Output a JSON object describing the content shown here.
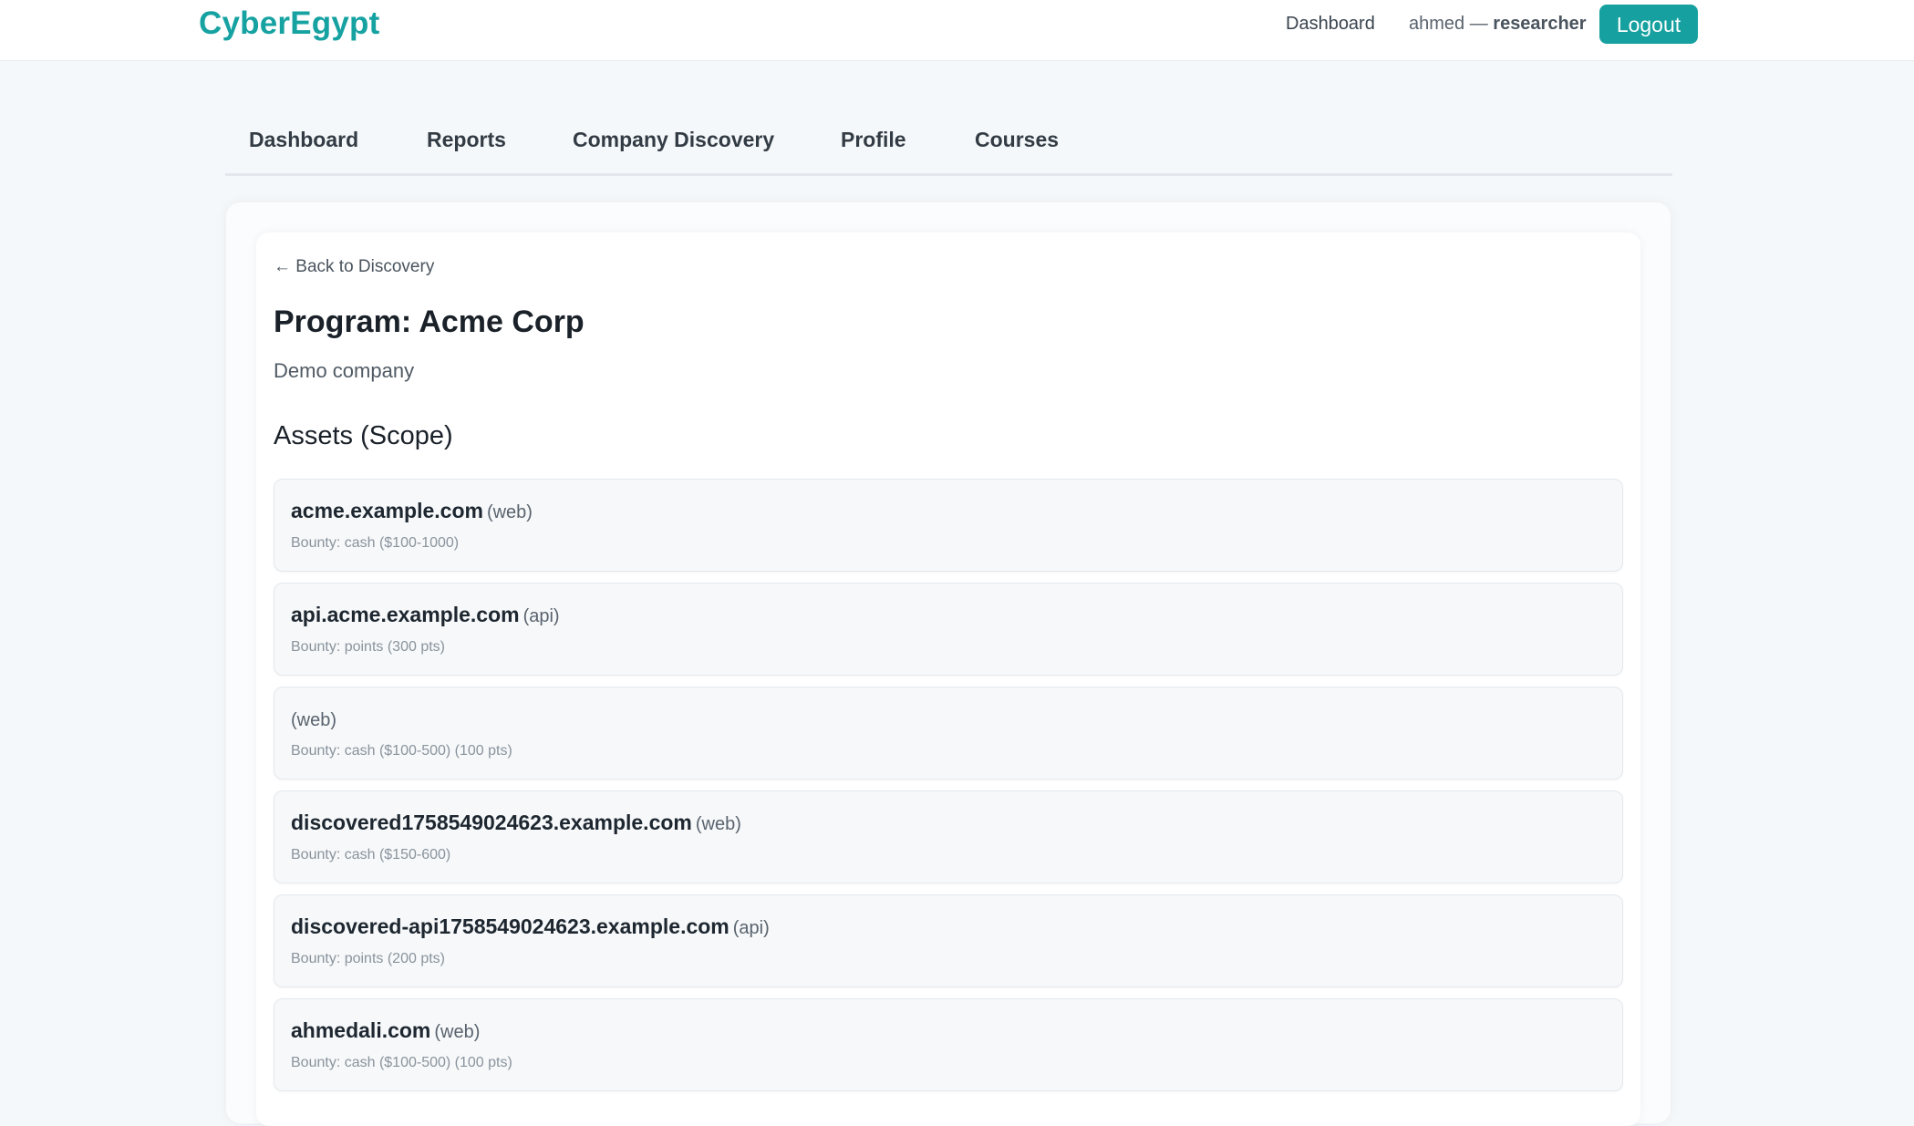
{
  "brand": {
    "name": "CyberEgypt",
    "color": "#17a2a2"
  },
  "topbar": {
    "dashboard_link": "Dashboard",
    "user": "ahmed",
    "separator": "—",
    "role": "researcher",
    "logout_label": "Logout"
  },
  "tabs": [
    {
      "label": "Dashboard"
    },
    {
      "label": "Reports"
    },
    {
      "label": "Company Discovery"
    },
    {
      "label": "Profile"
    },
    {
      "label": "Courses"
    }
  ],
  "program": {
    "back_link": "← Back to Discovery",
    "title": "Program: Acme Corp",
    "description": "Demo company",
    "assets_heading": "Assets (Scope)"
  },
  "assets": [
    {
      "host": "acme.example.com",
      "type": "(web)",
      "bounty": "Bounty: cash ($100-1000)"
    },
    {
      "host": "api.acme.example.com",
      "type": "(api)",
      "bounty": "Bounty: points (300 pts)"
    },
    {
      "host": "",
      "type": "(web)",
      "bounty": "Bounty: cash ($100-500) (100 pts)"
    },
    {
      "host": "discovered1758549024623.example.com",
      "type": "(web)",
      "bounty": "Bounty: cash ($150-600)"
    },
    {
      "host": "discovered-api1758549024623.example.com",
      "type": "(api)",
      "bounty": "Bounty: points (200 pts)"
    },
    {
      "host": "ahmedali.com",
      "type": "(web)",
      "bounty": "Bounty: cash ($100-500) (100 pts)"
    }
  ],
  "colors": {
    "accent": "#16a0a0",
    "page_background": "#f5f8fa"
  }
}
